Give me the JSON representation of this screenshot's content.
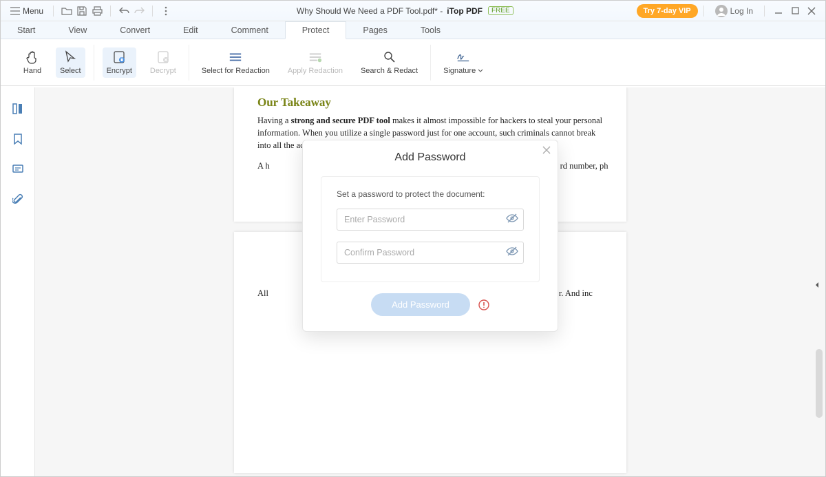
{
  "title": {
    "menu": "Menu",
    "filename": "Why Should We Need a PDF Tool.pdf* - ",
    "app": "iTop PDF",
    "free": "FREE",
    "vip": "Try 7-day VIP",
    "login": "Log In"
  },
  "tabs": {
    "start": "Start",
    "view": "View",
    "convert": "Convert",
    "edit": "Edit",
    "comment": "Comment",
    "protect": "Protect",
    "pages": "Pages",
    "tools": "Tools"
  },
  "ribbon": {
    "hand": "Hand",
    "select": "Select",
    "encrypt": "Encrypt",
    "decrypt": "Decrypt",
    "select_redact": "Select for Redaction",
    "apply_redact": "Apply Redaction",
    "search_redact": "Search & Redact",
    "signature": "Signature"
  },
  "doc": {
    "heading": "Our Takeaway",
    "p1a": "Having a ",
    "p1b": "strong and secure PDF tool",
    "p1c": " makes it almost impossible for hackers to steal your personal information. When you utilize a single password just for one account, such criminals cannot break into all the accounts with only one stolen password.",
    "p2": "A h                                                                                                                                       rd number, ph                                                                                                                                       ed to im",
    "p3": "All                                                                                                                                       r. And inc                                                                                                                                       ve way!!"
  },
  "modal": {
    "title": "Add Password",
    "hint": "Set a password to protect the document:",
    "ph_enter": "Enter Password",
    "ph_confirm": "Confirm Password",
    "button": "Add Password"
  }
}
